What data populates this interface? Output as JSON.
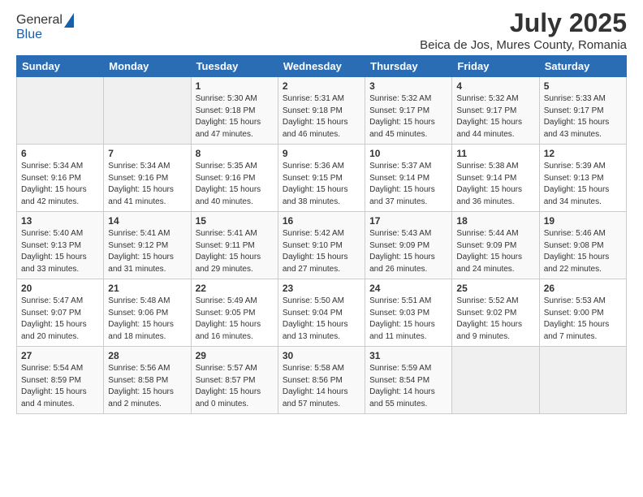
{
  "header": {
    "logo_general": "General",
    "logo_blue": "Blue",
    "main_title": "July 2025",
    "subtitle": "Beica de Jos, Mures County, Romania"
  },
  "weekdays": [
    "Sunday",
    "Monday",
    "Tuesday",
    "Wednesday",
    "Thursday",
    "Friday",
    "Saturday"
  ],
  "weeks": [
    [
      {
        "day": "",
        "info": ""
      },
      {
        "day": "",
        "info": ""
      },
      {
        "day": "1",
        "info": "Sunrise: 5:30 AM\nSunset: 9:18 PM\nDaylight: 15 hours and 47 minutes."
      },
      {
        "day": "2",
        "info": "Sunrise: 5:31 AM\nSunset: 9:18 PM\nDaylight: 15 hours and 46 minutes."
      },
      {
        "day": "3",
        "info": "Sunrise: 5:32 AM\nSunset: 9:17 PM\nDaylight: 15 hours and 45 minutes."
      },
      {
        "day": "4",
        "info": "Sunrise: 5:32 AM\nSunset: 9:17 PM\nDaylight: 15 hours and 44 minutes."
      },
      {
        "day": "5",
        "info": "Sunrise: 5:33 AM\nSunset: 9:17 PM\nDaylight: 15 hours and 43 minutes."
      }
    ],
    [
      {
        "day": "6",
        "info": "Sunrise: 5:34 AM\nSunset: 9:16 PM\nDaylight: 15 hours and 42 minutes."
      },
      {
        "day": "7",
        "info": "Sunrise: 5:34 AM\nSunset: 9:16 PM\nDaylight: 15 hours and 41 minutes."
      },
      {
        "day": "8",
        "info": "Sunrise: 5:35 AM\nSunset: 9:16 PM\nDaylight: 15 hours and 40 minutes."
      },
      {
        "day": "9",
        "info": "Sunrise: 5:36 AM\nSunset: 9:15 PM\nDaylight: 15 hours and 38 minutes."
      },
      {
        "day": "10",
        "info": "Sunrise: 5:37 AM\nSunset: 9:14 PM\nDaylight: 15 hours and 37 minutes."
      },
      {
        "day": "11",
        "info": "Sunrise: 5:38 AM\nSunset: 9:14 PM\nDaylight: 15 hours and 36 minutes."
      },
      {
        "day": "12",
        "info": "Sunrise: 5:39 AM\nSunset: 9:13 PM\nDaylight: 15 hours and 34 minutes."
      }
    ],
    [
      {
        "day": "13",
        "info": "Sunrise: 5:40 AM\nSunset: 9:13 PM\nDaylight: 15 hours and 33 minutes."
      },
      {
        "day": "14",
        "info": "Sunrise: 5:41 AM\nSunset: 9:12 PM\nDaylight: 15 hours and 31 minutes."
      },
      {
        "day": "15",
        "info": "Sunrise: 5:41 AM\nSunset: 9:11 PM\nDaylight: 15 hours and 29 minutes."
      },
      {
        "day": "16",
        "info": "Sunrise: 5:42 AM\nSunset: 9:10 PM\nDaylight: 15 hours and 27 minutes."
      },
      {
        "day": "17",
        "info": "Sunrise: 5:43 AM\nSunset: 9:09 PM\nDaylight: 15 hours and 26 minutes."
      },
      {
        "day": "18",
        "info": "Sunrise: 5:44 AM\nSunset: 9:09 PM\nDaylight: 15 hours and 24 minutes."
      },
      {
        "day": "19",
        "info": "Sunrise: 5:46 AM\nSunset: 9:08 PM\nDaylight: 15 hours and 22 minutes."
      }
    ],
    [
      {
        "day": "20",
        "info": "Sunrise: 5:47 AM\nSunset: 9:07 PM\nDaylight: 15 hours and 20 minutes."
      },
      {
        "day": "21",
        "info": "Sunrise: 5:48 AM\nSunset: 9:06 PM\nDaylight: 15 hours and 18 minutes."
      },
      {
        "day": "22",
        "info": "Sunrise: 5:49 AM\nSunset: 9:05 PM\nDaylight: 15 hours and 16 minutes."
      },
      {
        "day": "23",
        "info": "Sunrise: 5:50 AM\nSunset: 9:04 PM\nDaylight: 15 hours and 13 minutes."
      },
      {
        "day": "24",
        "info": "Sunrise: 5:51 AM\nSunset: 9:03 PM\nDaylight: 15 hours and 11 minutes."
      },
      {
        "day": "25",
        "info": "Sunrise: 5:52 AM\nSunset: 9:02 PM\nDaylight: 15 hours and 9 minutes."
      },
      {
        "day": "26",
        "info": "Sunrise: 5:53 AM\nSunset: 9:00 PM\nDaylight: 15 hours and 7 minutes."
      }
    ],
    [
      {
        "day": "27",
        "info": "Sunrise: 5:54 AM\nSunset: 8:59 PM\nDaylight: 15 hours and 4 minutes."
      },
      {
        "day": "28",
        "info": "Sunrise: 5:56 AM\nSunset: 8:58 PM\nDaylight: 15 hours and 2 minutes."
      },
      {
        "day": "29",
        "info": "Sunrise: 5:57 AM\nSunset: 8:57 PM\nDaylight: 15 hours and 0 minutes."
      },
      {
        "day": "30",
        "info": "Sunrise: 5:58 AM\nSunset: 8:56 PM\nDaylight: 14 hours and 57 minutes."
      },
      {
        "day": "31",
        "info": "Sunrise: 5:59 AM\nSunset: 8:54 PM\nDaylight: 14 hours and 55 minutes."
      },
      {
        "day": "",
        "info": ""
      },
      {
        "day": "",
        "info": ""
      }
    ]
  ]
}
